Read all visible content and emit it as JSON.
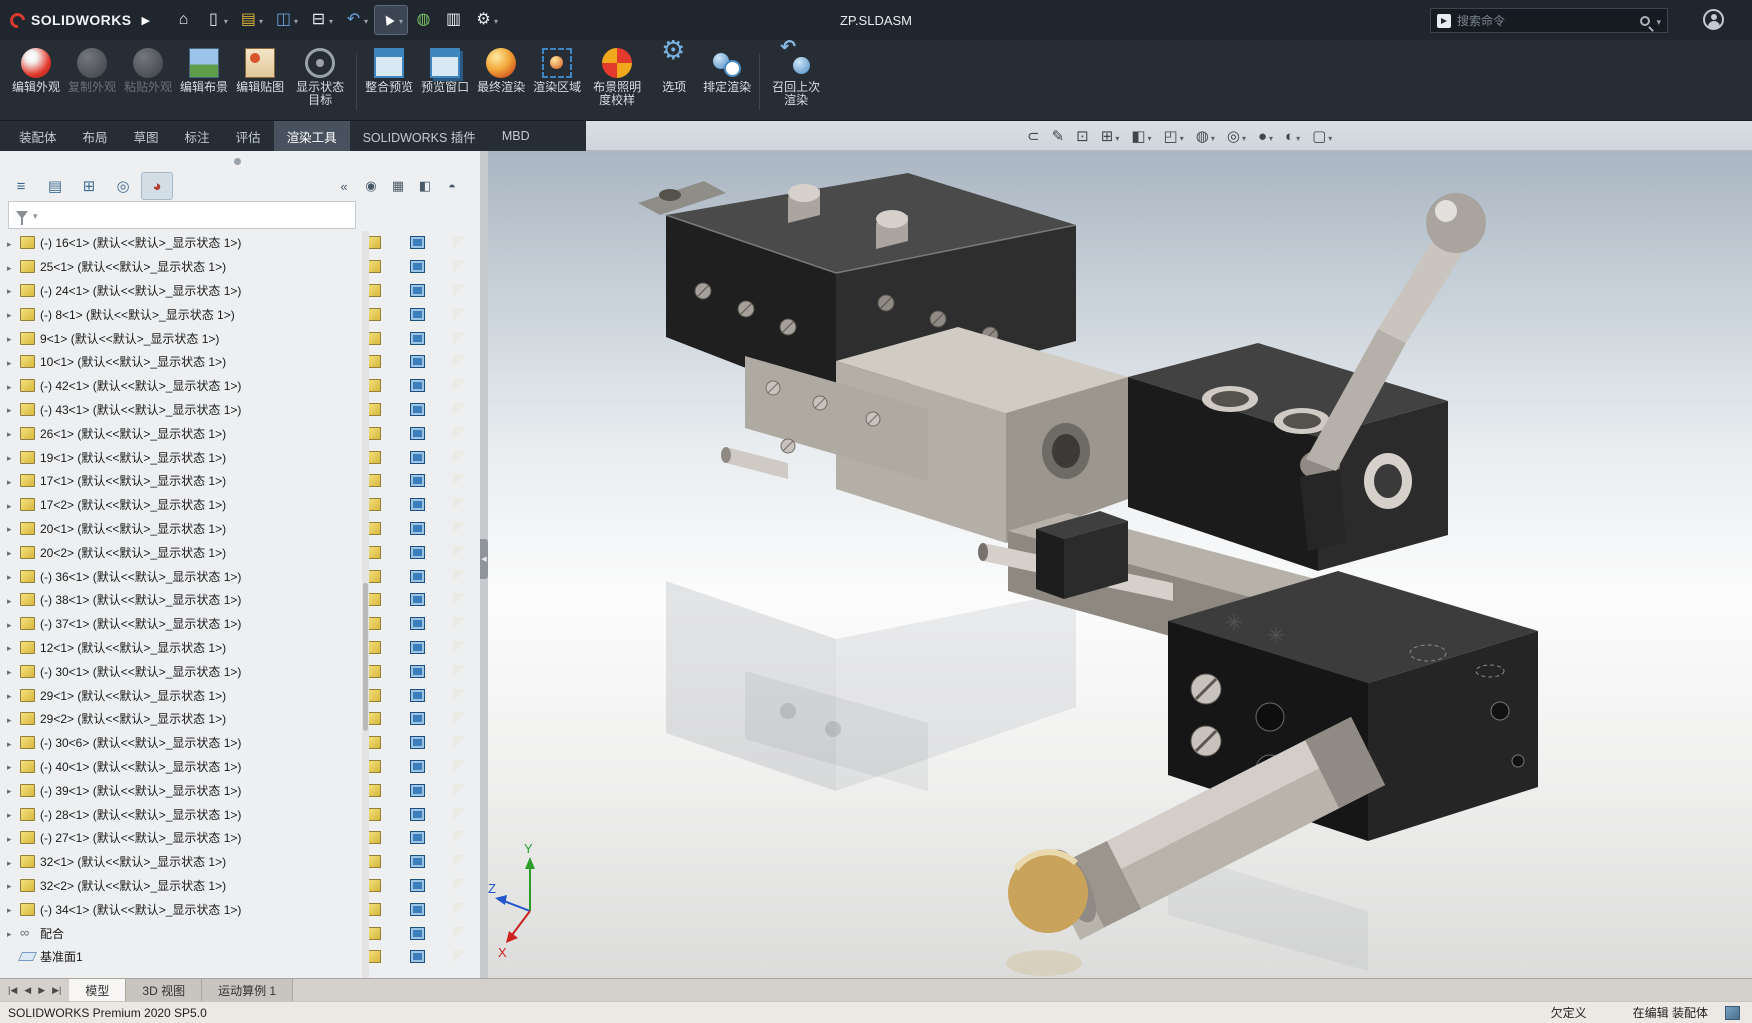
{
  "colors": {
    "titlebar_bg": "#20262e",
    "ribbon_bg": "#262d35",
    "active_tab_bg": "#48525e",
    "panel_bg": "#edeff1",
    "accent_blue": "#3f86c0",
    "part_icon_yellow": "#d8b83e",
    "brass": "#c9a35c"
  },
  "title_bar": {
    "app_name": "SOLIDWORKS",
    "document_title": "ZP.SLDASM",
    "search": {
      "placeholder": "搜索命令"
    },
    "quick_access": [
      {
        "name": "home-icon",
        "glyph": "⌂",
        "caret": false,
        "cls": "c-white"
      },
      {
        "name": "new-document-icon",
        "glyph": "▯",
        "caret": true,
        "cls": "c-white"
      },
      {
        "name": "open-document-icon",
        "glyph": "▤",
        "caret": true,
        "cls": "c-yellow"
      },
      {
        "name": "save-icon",
        "glyph": "◫",
        "caret": true,
        "cls": "c-blue"
      },
      {
        "name": "print-icon",
        "glyph": "⊟",
        "caret": true,
        "cls": "c-white"
      },
      {
        "name": "undo-icon",
        "glyph": "↶",
        "caret": true,
        "cls": "c-blue"
      },
      {
        "name": "select-cursor-icon",
        "glyph": "▲",
        "caret": true,
        "pressed": true
      },
      {
        "name": "rebuild-icon",
        "glyph": "◍",
        "caret": false,
        "cls": "c-green"
      },
      {
        "name": "document-properties-icon",
        "glyph": "▥",
        "caret": false,
        "cls": "c-white"
      },
      {
        "name": "options-gear-icon",
        "glyph": "⚙",
        "caret": true,
        "cls": "c-white"
      }
    ]
  },
  "ribbon": {
    "buttons": [
      {
        "name": "edit-appearance-button",
        "label": "编辑外观",
        "icon": "ic-appearance",
        "enabled": true
      },
      {
        "name": "copy-appearance-button",
        "label": "复制外观",
        "icon": "ic-appearance-copy",
        "enabled": false
      },
      {
        "name": "paste-appearance-button",
        "label": "粘贴外观",
        "icon": "ic-appearance-paste",
        "enabled": false
      },
      {
        "name": "edit-scene-button",
        "label": "编辑布景",
        "icon": "ic-scene",
        "enabled": true
      },
      {
        "name": "edit-decal-button",
        "label": "编辑贴图",
        "icon": "ic-decal",
        "enabled": true
      },
      {
        "name": "display-state-target-button",
        "label": "显示状态目标",
        "icon": "ic-target",
        "enabled": true
      },
      {
        "name": "ribbon-separator",
        "type": "sep",
        "interactable": false
      },
      {
        "name": "integrated-preview-button",
        "label": "整合预览",
        "icon": "ic-preview-inline",
        "enabled": true
      },
      {
        "name": "preview-window-button",
        "label": "预览窗口",
        "icon": "ic-preview-window",
        "enabled": true
      },
      {
        "name": "final-render-button",
        "label": "最终渲染",
        "icon": "ic-render",
        "enabled": true
      },
      {
        "name": "render-region-button",
        "label": "渲染区域",
        "icon": "ic-render-region",
        "enabled": true
      },
      {
        "name": "scene-illumination-proof-button",
        "label": "布景照明度校样",
        "icon": "ic-proof",
        "enabled": true
      },
      {
        "name": "options-button",
        "label": "选项",
        "icon": "ic-options",
        "enabled": true
      },
      {
        "name": "schedule-render-button",
        "label": "排定渲染",
        "icon": "ic-schedule",
        "enabled": true
      },
      {
        "name": "ribbon-separator",
        "type": "sep",
        "interactable": false
      },
      {
        "name": "recall-last-render-button",
        "label": "召回上次渲染",
        "icon": "ic-recall",
        "enabled": true
      }
    ]
  },
  "command_tabs": {
    "items": [
      {
        "name": "tab-assembly",
        "label": "装配体"
      },
      {
        "name": "tab-layout",
        "label": "布局"
      },
      {
        "name": "tab-sketch",
        "label": "草图"
      },
      {
        "name": "tab-markup",
        "label": "标注"
      },
      {
        "name": "tab-evaluate",
        "label": "评估"
      },
      {
        "name": "tab-render-tools",
        "label": "渲染工具",
        "active": true
      },
      {
        "name": "tab-solidworks-addins",
        "label": "SOLIDWORKS 插件"
      },
      {
        "name": "tab-mbd",
        "label": "MBD"
      }
    ]
  },
  "headsup": {
    "icons": [
      {
        "name": "paperclip-icon",
        "glyph": "⊂",
        "caret": false
      },
      {
        "name": "edit-markup-icon",
        "glyph": "✎",
        "caret": false
      },
      {
        "name": "zoom-fit-icon",
        "glyph": "⊡",
        "caret": false
      },
      {
        "name": "zoom-area-icon",
        "glyph": "⊞",
        "caret": true
      },
      {
        "name": "section-view-icon",
        "glyph": "◧",
        "caret": true
      },
      {
        "name": "view-orientation-icon",
        "glyph": "◰",
        "caret": true
      },
      {
        "name": "display-style-icon",
        "glyph": "◍",
        "caret": true
      },
      {
        "name": "hide-show-items-icon",
        "glyph": "◎",
        "caret": true
      },
      {
        "name": "edit-appearance-icon",
        "glyph": "●",
        "caret": true
      },
      {
        "name": "apply-scene-icon",
        "glyph": "◐",
        "caret": true
      },
      {
        "name": "view-settings-icon",
        "glyph": "▢",
        "caret": true
      }
    ]
  },
  "panel": {
    "tabs": [
      {
        "name": "featuremanager-tab",
        "glyph": "≡"
      },
      {
        "name": "propertymanager-tab",
        "glyph": "▤"
      },
      {
        "name": "configurationmanager-tab",
        "glyph": "⊞"
      },
      {
        "name": "dimxpertmanager-tab",
        "glyph": "◎"
      },
      {
        "name": "displaymanager-tab",
        "glyph": "◕",
        "active": true
      }
    ],
    "tools": [
      {
        "name": "collapse-panel-icon",
        "glyph": "«"
      },
      {
        "name": "show-hide-tree-items-icon",
        "glyph": "◉"
      },
      {
        "name": "display-pane-icon",
        "glyph": "▦"
      },
      {
        "name": "section-scope-icon",
        "glyph": "◧"
      },
      {
        "name": "appearances-sphere-icon",
        "glyph": "◓"
      }
    ]
  },
  "feature_tree": {
    "items": [
      {
        "label": "(-) 16<1> (默认<<默认>_显示状态 1>)",
        "type": "part"
      },
      {
        "label": "25<1> (默认<<默认>_显示状态 1>)",
        "type": "part"
      },
      {
        "label": "(-) 24<1> (默认<<默认>_显示状态 1>)",
        "type": "part"
      },
      {
        "label": "(-) 8<1> (默认<<默认>_显示状态 1>)",
        "type": "part"
      },
      {
        "label": "9<1> (默认<<默认>_显示状态 1>)",
        "type": "part"
      },
      {
        "label": "10<1> (默认<<默认>_显示状态 1>)",
        "type": "part"
      },
      {
        "label": "(-) 42<1> (默认<<默认>_显示状态 1>)",
        "type": "part"
      },
      {
        "label": "(-) 43<1> (默认<<默认>_显示状态 1>)",
        "type": "part"
      },
      {
        "label": "26<1> (默认<<默认>_显示状态 1>)",
        "type": "part"
      },
      {
        "label": "19<1> (默认<<默认>_显示状态 1>)",
        "type": "part"
      },
      {
        "label": "17<1> (默认<<默认>_显示状态 1>)",
        "type": "part"
      },
      {
        "label": "17<2> (默认<<默认>_显示状态 1>)",
        "type": "part"
      },
      {
        "label": "20<1> (默认<<默认>_显示状态 1>)",
        "type": "part"
      },
      {
        "label": "20<2> (默认<<默认>_显示状态 1>)",
        "type": "part"
      },
      {
        "label": "(-) 36<1> (默认<<默认>_显示状态 1>)",
        "type": "part"
      },
      {
        "label": "(-) 38<1> (默认<<默认>_显示状态 1>)",
        "type": "part"
      },
      {
        "label": "(-) 37<1> (默认<<默认>_显示状态 1>)",
        "type": "part"
      },
      {
        "label": "12<1> (默认<<默认>_显示状态 1>)",
        "type": "part"
      },
      {
        "label": "(-) 30<1> (默认<<默认>_显示状态 1>)",
        "type": "part"
      },
      {
        "label": "29<1> (默认<<默认>_显示状态 1>)",
        "type": "part"
      },
      {
        "label": "29<2> (默认<<默认>_显示状态 1>)",
        "type": "part"
      },
      {
        "label": "(-) 30<6> (默认<<默认>_显示状态 1>)",
        "type": "part"
      },
      {
        "label": "(-) 40<1> (默认<<默认>_显示状态 1>)",
        "type": "part"
      },
      {
        "label": "(-) 39<1> (默认<<默认>_显示状态 1>)",
        "type": "part"
      },
      {
        "label": "(-) 28<1> (默认<<默认>_显示状态 1>)",
        "type": "part"
      },
      {
        "label": "(-) 27<1> (默认<<默认>_显示状态 1>)",
        "type": "part"
      },
      {
        "label": "32<1> (默认<<默认>_显示状态 1>)",
        "type": "part"
      },
      {
        "label": "32<2> (默认<<默认>_显示状态 1>)",
        "type": "part"
      },
      {
        "label": "(-) 34<1> (默认<<默认>_显示状态 1>)",
        "type": "part"
      },
      {
        "label": "配合",
        "type": "mates"
      },
      {
        "label": "基准面1",
        "type": "plane"
      }
    ]
  },
  "viewport": {
    "triad": {
      "x": "X",
      "y": "Y",
      "z": "Z"
    }
  },
  "bottom_bar": {
    "nav": [
      "|◀",
      "◀",
      "▶",
      "▶|"
    ],
    "tabs": [
      {
        "name": "tab-model",
        "label": "模型",
        "active": true
      },
      {
        "name": "tab-3d-views",
        "label": "3D 视图"
      },
      {
        "name": "tab-motion-study",
        "label": "运动算例 1"
      }
    ]
  },
  "status_bar": {
    "left": "SOLIDWORKS Premium 2020 SP5.0",
    "right": [
      "欠定义",
      "在编辑 装配体"
    ]
  }
}
